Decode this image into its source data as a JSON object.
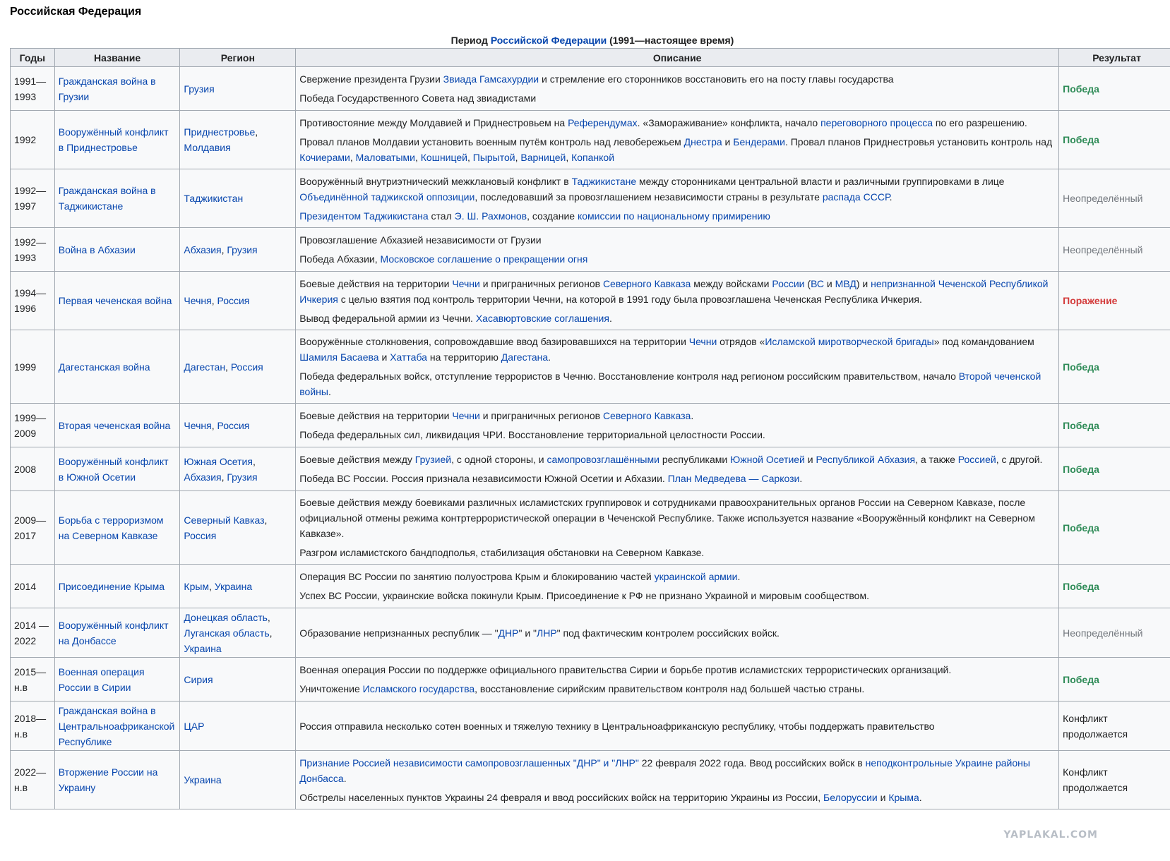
{
  "section_heading": "Российская Федерация",
  "caption": {
    "pre": "Период ",
    "link": "Российской Федерации",
    "post": " (1991—настоящее время)"
  },
  "headers": [
    "Годы",
    "Название",
    "Регион",
    "Описание",
    "Результат"
  ],
  "rows": [
    {
      "years": "1991—\n1993",
      "name": "Гражданская война в Грузии",
      "region": [
        {
          "t": "Грузия",
          "link": true
        }
      ],
      "desc": [
        [
          {
            "t": "Свержение президента Грузии "
          },
          {
            "t": "Звиада Гамсахурдии",
            "link": true
          },
          {
            "t": " и стремление его сторонников восстановить его на посту главы государства"
          }
        ],
        [
          {
            "t": "Победа Государственного Совета над звиадистами"
          }
        ]
      ],
      "result": "Победа",
      "result_type": "win",
      "height": 62
    },
    {
      "years": "1992",
      "name": "Вооружённый конфликт в Приднестровье",
      "region": [
        {
          "t": "Приднестровье",
          "link": true
        },
        {
          "t": ", "
        },
        {
          "t": "Молдавия",
          "link": true
        }
      ],
      "desc": [
        [
          {
            "t": "Противостояние между Молдавией и Приднестровьем на "
          },
          {
            "t": "Референдумах",
            "link": true
          },
          {
            "t": ". «Замораживание» конфликта, начало "
          },
          {
            "t": "переговорного процесса",
            "link": true
          },
          {
            "t": " по его разрешению."
          }
        ],
        [
          {
            "t": "Провал планов Молдавии установить военным путём контроль над левобережьем "
          },
          {
            "t": "Днестра",
            "link": true
          },
          {
            "t": " и "
          },
          {
            "t": "Бендерами",
            "link": true
          },
          {
            "t": ". Провал планов Приднестровья установить контроль над "
          },
          {
            "t": "Кочиерами",
            "link": true
          },
          {
            "t": ", "
          },
          {
            "t": "Маловатыми",
            "link": true
          },
          {
            "t": ", "
          },
          {
            "t": "Кошницей",
            "link": true
          },
          {
            "t": ", "
          },
          {
            "t": "Пырытой",
            "link": true
          },
          {
            "t": ", "
          },
          {
            "t": "Варницей",
            "link": true
          },
          {
            "t": ", "
          },
          {
            "t": "Копанкой",
            "link": true
          }
        ]
      ],
      "result": "Победа",
      "result_type": "win",
      "height": 83
    },
    {
      "years": "1992—\n1997",
      "name": "Гражданская война в Таджикистане",
      "region": [
        {
          "t": "Таджикистан",
          "link": true
        }
      ],
      "desc": [
        [
          {
            "t": "Вооружённый внутриэтнический межклановый конфликт в "
          },
          {
            "t": "Таджикистане",
            "link": true
          },
          {
            "t": " между сторонниками центральной власти и различными группировками в лице "
          },
          {
            "t": "Объединённой таджикской оппозиции",
            "link": true
          },
          {
            "t": ", последовавший за провозглашением независимости страны в результате "
          },
          {
            "t": "распада СССР",
            "link": true
          },
          {
            "t": "."
          }
        ],
        [
          {
            "t": "Президентом Таджикистана",
            "link": true
          },
          {
            "t": " стал "
          },
          {
            "t": "Э. Ш. Рахмонов",
            "link": true
          },
          {
            "t": ", создание "
          },
          {
            "t": "комиссии по национальному примирению",
            "link": true
          }
        ]
      ],
      "result": "Неопределённый",
      "result_type": "undef",
      "height": 83
    },
    {
      "years": "1992—\n1993",
      "name": "Война в Абхазии",
      "region": [
        {
          "t": "Абхазия",
          "link": true
        },
        {
          "t": ", "
        },
        {
          "t": "Грузия",
          "link": true
        }
      ],
      "desc": [
        [
          {
            "t": "Провозглашение Абхазией независимости от Грузии"
          }
        ],
        [
          {
            "t": "Победа Абхазии, "
          },
          {
            "t": "Московское соглашение о прекращении огня",
            "link": true
          }
        ]
      ],
      "result": "Неопределённый",
      "result_type": "undef",
      "height": 62
    },
    {
      "years": "1994—\n1996",
      "name": "Первая чеченская война",
      "region": [
        {
          "t": "Чечня",
          "link": true
        },
        {
          "t": ", "
        },
        {
          "t": "Россия",
          "link": true
        }
      ],
      "desc": [
        [
          {
            "t": "Боевые действия на территории "
          },
          {
            "t": "Чечни",
            "link": true
          },
          {
            "t": " и приграничных регионов "
          },
          {
            "t": "Северного Кавказа",
            "link": true
          },
          {
            "t": " между войсками "
          },
          {
            "t": "России",
            "link": true
          },
          {
            "t": " ("
          },
          {
            "t": "ВС",
            "link": true
          },
          {
            "t": " и "
          },
          {
            "t": "МВД",
            "link": true
          },
          {
            "t": ") и "
          },
          {
            "t": "непризнанной Чеченской Республикой Ичкерия",
            "link": true
          },
          {
            "t": " с целью взятия под контроль территории Чечни, на которой в 1991 году была провозглашена Чеченская Республика Ичкерия."
          }
        ],
        [
          {
            "t": "Вывод федеральной армии из Чечни. "
          },
          {
            "t": "Хасавюртовские соглашения",
            "link": true
          },
          {
            "t": "."
          }
        ]
      ],
      "result": "Поражение",
      "result_type": "loss",
      "height": 83
    },
    {
      "years": "1999",
      "name": "Дагестанская война",
      "region": [
        {
          "t": "Дагестан",
          "link": true
        },
        {
          "t": ", "
        },
        {
          "t": "Россия",
          "link": true
        }
      ],
      "desc": [
        [
          {
            "t": "Вооружённые столкновения, сопровождавшие ввод базировавшихся на территории "
          },
          {
            "t": "Чечни",
            "link": true
          },
          {
            "t": " отрядов «"
          },
          {
            "t": "Исламской миротворческой бригады",
            "link": true
          },
          {
            "t": "» под командованием "
          },
          {
            "t": "Шамиля Басаева",
            "link": true
          },
          {
            "t": " и "
          },
          {
            "t": "Хаттаба",
            "link": true
          },
          {
            "t": " на территорию "
          },
          {
            "t": "Дагестана",
            "link": true
          },
          {
            "t": "."
          }
        ],
        [
          {
            "t": "Победа федеральных войск, отступление террористов в Чечню. Восстановление контроля над регионом российским правительством, начало "
          },
          {
            "t": "Второй чеченской войны",
            "link": true
          },
          {
            "t": "."
          }
        ]
      ],
      "result": "Победа",
      "result_type": "win",
      "height": 104
    },
    {
      "years": "1999—\n2009",
      "name": "Вторая чеченская война",
      "region": [
        {
          "t": "Чечня",
          "link": true
        },
        {
          "t": ", "
        },
        {
          "t": "Россия",
          "link": true
        }
      ],
      "desc": [
        [
          {
            "t": "Боевые действия на территории "
          },
          {
            "t": "Чечни",
            "link": true
          },
          {
            "t": " и приграничных регионов "
          },
          {
            "t": "Северного Кавказа",
            "link": true
          },
          {
            "t": "."
          }
        ],
        [
          {
            "t": "Победа федеральных сил, ликвидация ЧРИ. Восстановление территориальной целостности России."
          }
        ]
      ],
      "result": "Победа",
      "result_type": "win",
      "height": 62
    },
    {
      "years": "2008",
      "name": "Вооружённый конфликт в Южной Осетии",
      "region": [
        {
          "t": "Южная Осетия",
          "link": true
        },
        {
          "t": ", "
        },
        {
          "t": "Абхазия",
          "link": true
        },
        {
          "t": ", "
        },
        {
          "t": "Грузия",
          "link": true
        }
      ],
      "desc": [
        [
          {
            "t": "Боевые действия между "
          },
          {
            "t": "Грузией",
            "link": true
          },
          {
            "t": ", с одной стороны, и "
          },
          {
            "t": "самопровозглашёнными",
            "link": true
          },
          {
            "t": " республиками "
          },
          {
            "t": "Южной Осетией",
            "link": true
          },
          {
            "t": " и "
          },
          {
            "t": "Республикой Абхазия",
            "link": true
          },
          {
            "t": ", а также "
          },
          {
            "t": "Россией",
            "link": true
          },
          {
            "t": ", с другой."
          }
        ],
        [
          {
            "t": "Победа ВС России. Россия признала независимости Южной Осетии и Абхазии. "
          },
          {
            "t": "План Медведева — Саркози",
            "link": true
          },
          {
            "t": "."
          }
        ]
      ],
      "result": "Победа",
      "result_type": "win",
      "height": 62
    },
    {
      "years": "2009—\n2017",
      "name": "Борьба с терроризмом на Северном Кавказе",
      "region": [
        {
          "t": "Северный Кавказ",
          "link": true
        },
        {
          "t": ", "
        },
        {
          "t": "Россия",
          "link": true
        }
      ],
      "desc": [
        [
          {
            "t": "Боевые действия между боевиками различных исламистских группировок и сотрудниками правоохранительных органов России на Северном Кавказе, после официальной отмены режима контртеррористической операции в Чеченской Республике. Также используется название «Вооружённый конфликт на Северном Кавказе»."
          }
        ],
        [
          {
            "t": "Разгром исламистского бандподполья, стабилизация обстановки на Северном Кавказе."
          }
        ]
      ],
      "result": "Победа",
      "result_type": "win",
      "height": 104
    },
    {
      "years": "2014",
      "name": "Присоединение Крыма",
      "region": [
        {
          "t": "Крым",
          "link": true
        },
        {
          "t": ", "
        },
        {
          "t": "Украина",
          "link": true
        }
      ],
      "desc": [
        [
          {
            "t": "Операция ВС России по занятию полуострова Крым и блокированию частей "
          },
          {
            "t": "украинской армии",
            "link": true
          },
          {
            "t": "."
          }
        ],
        [
          {
            "t": "Успех ВС России, украинские войска покинули Крым. Присоединение к РФ не признано Украиной и мировым сообществом."
          }
        ]
      ],
      "result": "Победа",
      "result_type": "win",
      "height": 62
    },
    {
      "years": "2014 —\n2022",
      "name": "Вооружённый конфликт на Донбассе",
      "region": [
        {
          "t": "Донецкая область",
          "link": true
        },
        {
          "t": ", "
        },
        {
          "t": "Луганская область",
          "link": true
        },
        {
          "t": ", "
        },
        {
          "t": "Украина",
          "link": true
        }
      ],
      "desc": [
        [
          {
            "t": "Образование непризнанных республик — \""
          },
          {
            "t": "ДНР",
            "link": true
          },
          {
            "t": "\" и \""
          },
          {
            "t": "ЛНР",
            "link": true
          },
          {
            "t": "\" под фактическим контролем российских войск."
          }
        ]
      ],
      "result": "Неопределённый",
      "result_type": "undef",
      "height": 70
    },
    {
      "years": "2015—\nн.в",
      "name": "Военная операция России в Сирии",
      "region": [
        {
          "t": "Сирия",
          "link": true
        }
      ],
      "desc": [
        [
          {
            "t": "Военная операция России по поддержке официального правительства Сирии и борьбе против исламистских террористических организаций."
          }
        ],
        [
          {
            "t": "Уничтожение "
          },
          {
            "t": "Исламского государства",
            "link": true
          },
          {
            "t": ", восстановление сирийским правительством контроля над большей частью страны."
          }
        ]
      ],
      "result": "Победа",
      "result_type": "win",
      "height": 62
    },
    {
      "years": "2018—\nн.в",
      "name": "Гражданская война в Центральноафриканской Республике",
      "region": [
        {
          "t": "ЦАР",
          "link": true
        }
      ],
      "desc": [
        [
          {
            "t": "Россия отправила несколько сотен военных и тяжелую технику в Центральноафриканскую республику, чтобы поддержать правительство"
          }
        ]
      ],
      "result": "Конфликт продолжается",
      "result_type": "cont",
      "height": 70
    },
    {
      "years": "2022—\nн.в",
      "name": "Вторжение России на Украину",
      "region": [
        {
          "t": "Украина",
          "link": true
        }
      ],
      "desc": [
        [
          {
            "t": "Признание Россией независимости самопровозглашенных \"ДНР\" и \"ЛНР\"",
            "link": true
          },
          {
            "t": " 22 февраля 2022 года. Ввод российских войск в "
          },
          {
            "t": "неподконтрольные Украине районы Донбасса",
            "link": true
          },
          {
            "t": "."
          }
        ],
        [
          {
            "t": "Обстрелы населенных пунктов Украины 24 февраля и ввод российских войск на территорию Украины из России, "
          },
          {
            "t": "Белоруссии",
            "link": true
          },
          {
            "t": " и "
          },
          {
            "t": "Крыма",
            "link": true
          },
          {
            "t": "."
          }
        ]
      ],
      "result": "Конфликт продолжается",
      "result_type": "cont",
      "height": 83
    }
  ],
  "watermark": "YAPLAKAL.COM",
  "colors": {
    "link": "#0645ad",
    "win": "#2e8b57",
    "loss": "#d33b3b",
    "undefined": "#72777d",
    "header_bg": "#eaecf0",
    "cell_bg": "#f8f9fa",
    "border": "#a2a9b1"
  }
}
